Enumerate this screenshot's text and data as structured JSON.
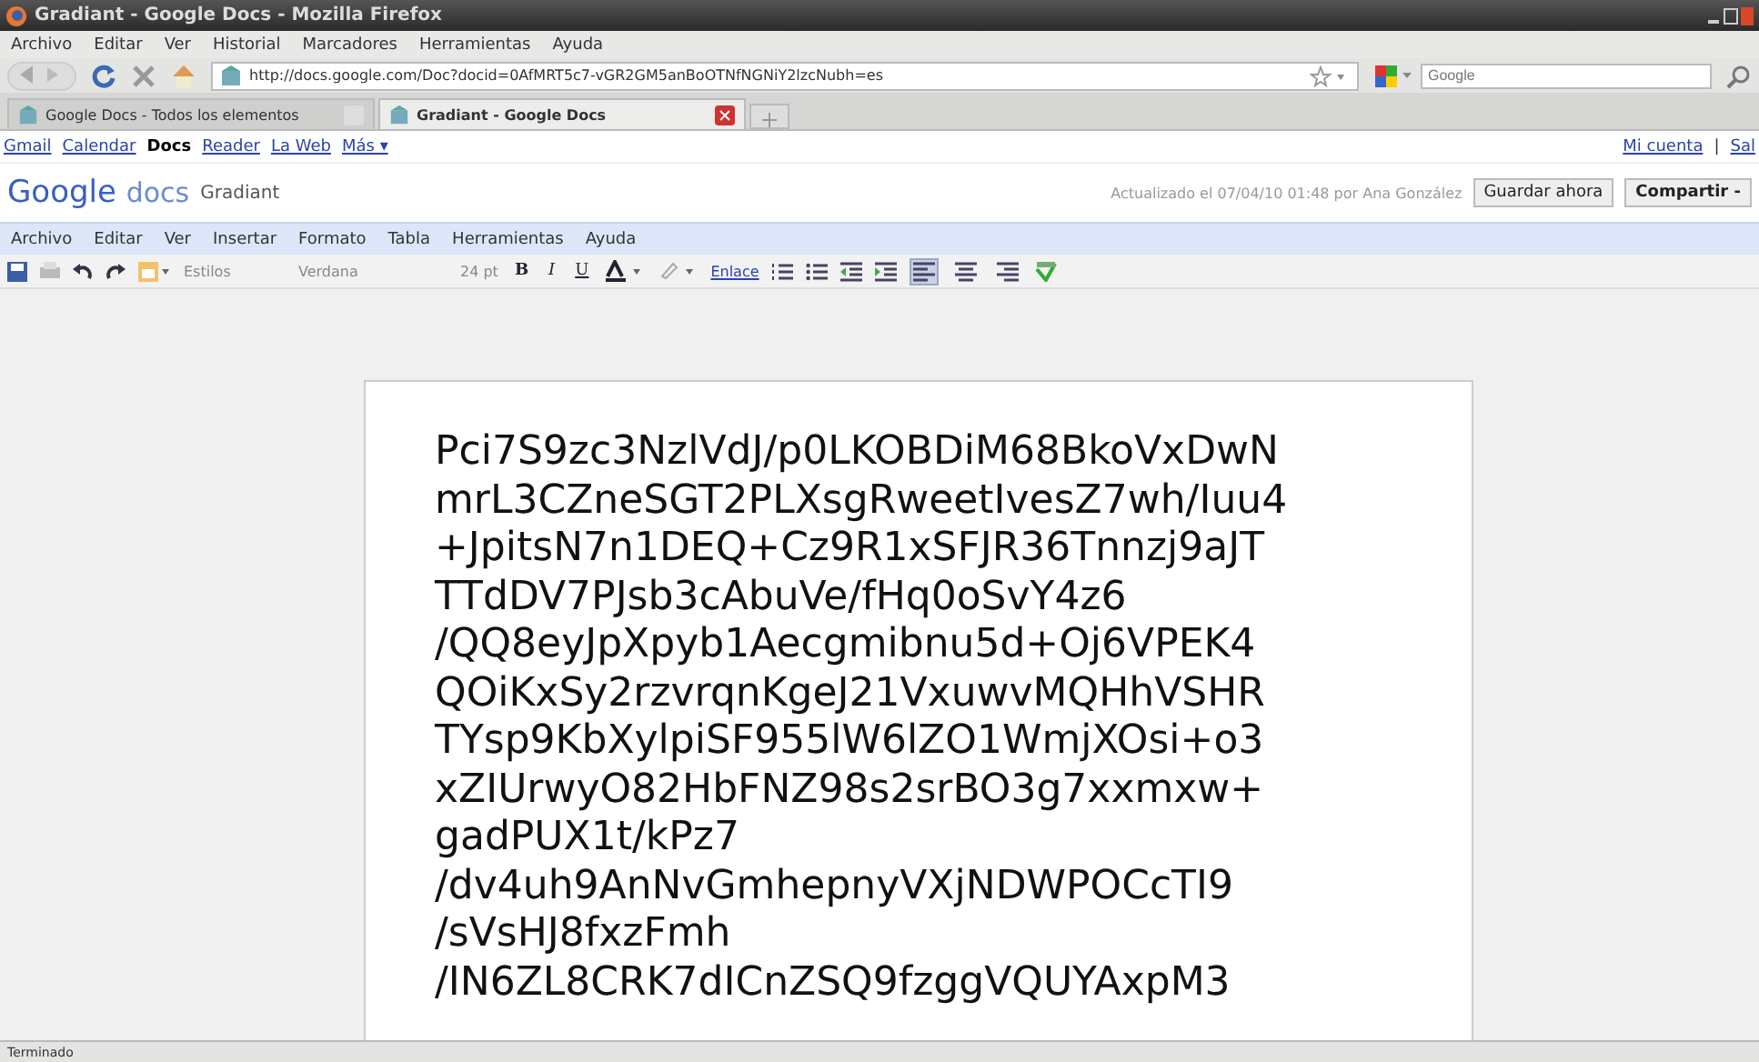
{
  "window": {
    "title": "Gradiant - Google Docs - Mozilla Firefox"
  },
  "browser_menu": [
    "Archivo",
    "Editar",
    "Ver",
    "Historial",
    "Marcadores",
    "Herramientas",
    "Ayuda"
  ],
  "nav": {
    "url": "http://docs.google.com/Doc?docid=0AfMRT5c7-vGR2GM5anBoOTNfNGNiY2lzcNubh=es",
    "search_placeholder": "Google"
  },
  "tabs": [
    {
      "label": "Google Docs - Todos los elementos",
      "selected": false
    },
    {
      "label": "Gradiant - Google Docs",
      "selected": true
    }
  ],
  "google_bar": {
    "links": [
      {
        "label": "Gmail",
        "selected": false
      },
      {
        "label": "Calendar",
        "selected": false
      },
      {
        "label": "Docs",
        "selected": true
      },
      {
        "label": "Reader",
        "selected": false
      },
      {
        "label": "La Web",
        "selected": false
      },
      {
        "label": "Más ▾",
        "selected": false
      }
    ],
    "account": [
      "Mi cuenta",
      "|",
      "Sal"
    ]
  },
  "doc_header": {
    "logo_google": "Google",
    "logo_docs": "docs",
    "doc_name": "Gradiant",
    "saved": "Actualizado el 07/04/10 01:48 por Ana González",
    "buttons": [
      "Guardar ahora",
      "Compartir -"
    ]
  },
  "doc_menu": [
    "Archivo",
    "Editar",
    "Ver",
    "Insertar",
    "Formato",
    "Tabla",
    "Herramientas",
    "Ayuda"
  ],
  "toolbar": {
    "style": "Estilos",
    "font": "Verdana",
    "size": "24 pt",
    "bold": "B",
    "italic": "I",
    "underline": "U",
    "link": "Enlace",
    "alignment": [
      {
        "selected": true
      },
      {
        "selected": false
      },
      {
        "selected": false
      }
    ]
  },
  "document": {
    "lines": [
      "Pci7S9zc3NzlVdJ/p0LKOBDiM68BkoVxDwN",
      "mrL3CZneSGT2PLXsgRweetIvesZ7wh/Iuu4",
      "+JpitsN7n1DEQ+Cz9R1xSFJR36Tnnzj9aJT",
      "TTdDV7PJsb3cAbuVe/fHq0oSvY4z6",
      "/QQ8eyJpXpyb1Aecgmibnu5d+Oj6VPEK4",
      "QOiKxSy2rzvrqnKgeJ21VxuwvMQHhVSHR",
      "TYsp9KbXylpiSF955lW6lZO1WmjXOsi+o3",
      "xZIUrwyO82HbFNZ98s2srBO3g7xxmxw+",
      "gadPUX1t/kPz7",
      "/dv4uh9AnNvGmhepnyVXjNDWPOCcTI9",
      "/sVsHJ8fxzFmh",
      "/IN6ZL8CRK7dICnZSQ9fzggVQUYAxpM3"
    ]
  },
  "status_bar": {
    "text": "Terminado"
  }
}
